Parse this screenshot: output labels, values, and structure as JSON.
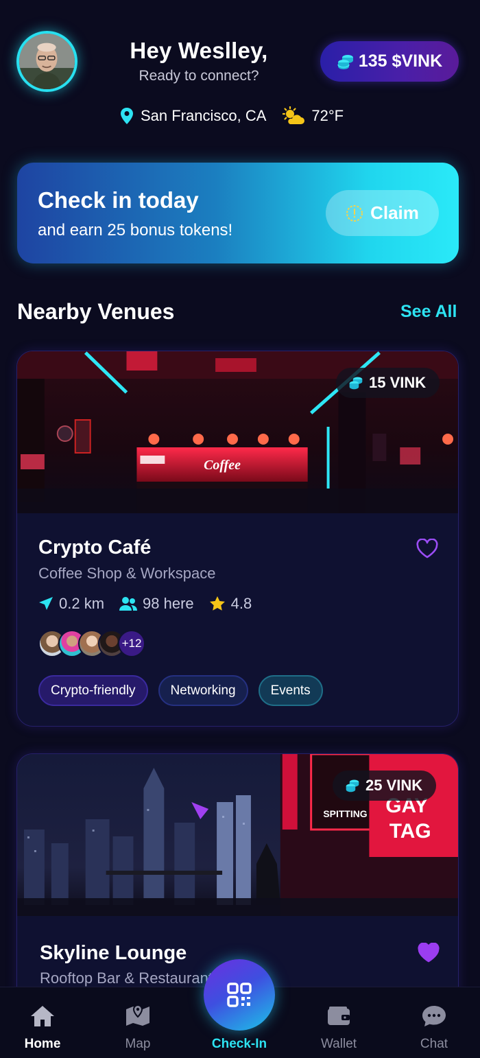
{
  "header": {
    "greeting": "Hey Weslley,",
    "subtitle": "Ready to connect?",
    "token_balance": "135 $VINK",
    "location": "San Francisco, CA",
    "temperature": "72°F"
  },
  "banner": {
    "title": "Check in today",
    "description": "and earn 25 bonus tokens!",
    "claim_label": "Claim"
  },
  "nearby": {
    "title": "Nearby Venues",
    "see_all": "See All"
  },
  "venues": [
    {
      "reward": "15 VINK",
      "name": "Crypto Café",
      "type": "Coffee Shop & Workspace",
      "distance": "0.2 km",
      "people_here": "98 here",
      "rating": "4.8",
      "more_people": "+12",
      "favorited": false,
      "photo_sign": "Coffee",
      "tags": [
        "Crypto-friendly",
        "Networking",
        "Events"
      ]
    },
    {
      "reward": "25 VINK",
      "name": "Skyline Lounge",
      "type": "Rooftop Bar & Restaurant",
      "favorited": true,
      "photo_signs": [
        "GAY",
        "TAG",
        "SPITTING"
      ]
    }
  ],
  "nav": {
    "home": "Home",
    "map": "Map",
    "checkin": "Check-In",
    "wallet": "Wallet",
    "chat": "Chat"
  },
  "colors": {
    "background": "#0b0b1f",
    "accent_cyan": "#2de3f2",
    "accent_purple": "#8a3cf0",
    "token_pill": "#3a1fa8"
  },
  "icons": [
    "map-pin-icon",
    "weather-icon",
    "coins-icon",
    "clock-icon",
    "heart-icon",
    "navigation-icon",
    "people-icon",
    "star-icon",
    "home-icon",
    "map-icon",
    "qr-code-icon",
    "wallet-icon",
    "chat-icon"
  ]
}
